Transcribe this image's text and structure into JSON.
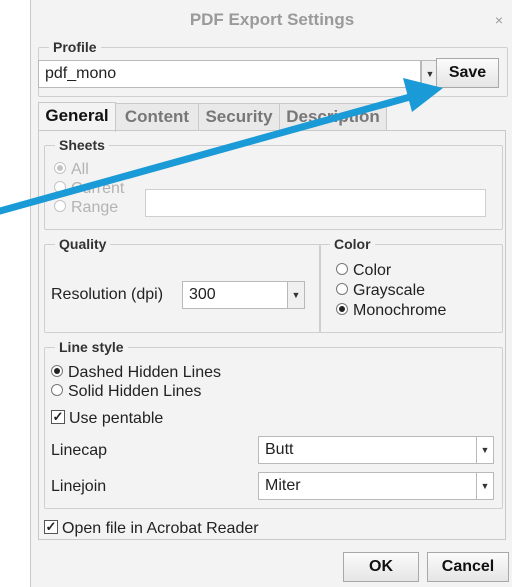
{
  "window": {
    "title": "PDF Export Settings",
    "close_glyph": "×"
  },
  "profile": {
    "label": "Profile",
    "value": "pdf_mono",
    "save_label": "Save"
  },
  "tabs": [
    {
      "label": "General",
      "active": true
    },
    {
      "label": "Content",
      "active": false
    },
    {
      "label": "Security",
      "active": false
    },
    {
      "label": "Description",
      "active": false
    }
  ],
  "sheets": {
    "label": "Sheets",
    "options": [
      "All",
      "Current",
      "Range"
    ],
    "range_value": ""
  },
  "quality": {
    "label": "Quality",
    "resolution_label": "Resolution (dpi)",
    "resolution_value": "300"
  },
  "color": {
    "label": "Color",
    "options": [
      "Color",
      "Grayscale",
      "Monochrome"
    ],
    "selected": "Monochrome"
  },
  "line_style": {
    "label": "Line style",
    "options": [
      "Dashed Hidden Lines",
      "Solid Hidden Lines"
    ],
    "selected": "Dashed Hidden Lines",
    "use_pentable_label": "Use pentable",
    "linecap_label": "Linecap",
    "linecap_value": "Butt",
    "linejoin_label": "Linejoin",
    "linejoin_value": "Miter"
  },
  "open_acrobat_label": "Open file in Acrobat Reader",
  "footer": {
    "ok_label": "OK",
    "cancel_label": "Cancel"
  },
  "check_glyph": "✓",
  "dropdown_glyph": "▼",
  "accent_color": "#1a9ad6"
}
